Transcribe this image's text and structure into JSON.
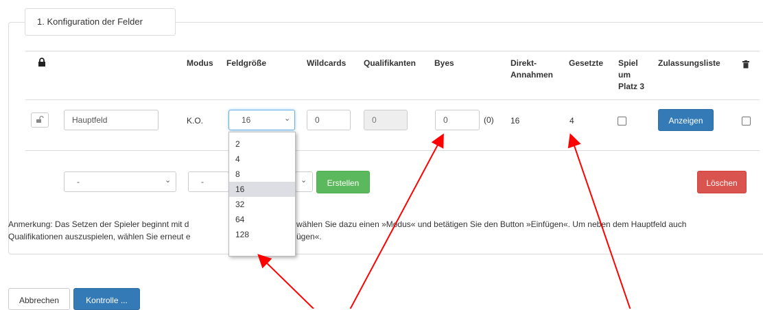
{
  "section_title": "1. Konfiguration der Felder",
  "headers": {
    "modus": "Modus",
    "feldgroesse": "Feldgröße",
    "wildcards": "Wildcards",
    "qualifikanten": "Qualifikanten",
    "byes": "Byes",
    "direkt_l1": "Direkt-",
    "direkt_l2": "Annahmen",
    "gesetzte": "Gesetzte",
    "spiel_l1": "Spiel",
    "spiel_l2": "um",
    "spiel_l3": "Platz 3",
    "zulassung": "Zulassungsliste"
  },
  "row": {
    "name": "Hauptfeld",
    "modus": "K.O.",
    "feldgroesse": "16",
    "wildcards": "0",
    "qualifikanten": "0",
    "byes": "0",
    "byes_hint": "(0)",
    "direkt": "16",
    "gesetzte": "4",
    "spiel_um_platz3": false,
    "zulassung_button": "Anzeigen",
    "delete_checked": false
  },
  "feldgroesse_options": [
    "2",
    "4",
    "8",
    "16",
    "32",
    "64",
    "128"
  ],
  "feldgroesse_selected": "16",
  "create_row": {
    "select1": "-",
    "select2": "-",
    "create_button": "Erstellen",
    "delete_button": "Löschen"
  },
  "note_line1_a": "Anmerkung: Das Setzen der Spieler beginnt mit d",
  "note_line1_b": "wählen Sie dazu einen »Modus« und betätigen Sie den Button »Einfügen«. Um neben dem Hauptfeld auch",
  "note_line2_a": "Qualifikationen auszuspielen, wählen Sie erneut e",
  "note_line2_b": "ügen«.",
  "footer": {
    "cancel": "Abbrechen",
    "check": "Kontrolle ..."
  },
  "colors": {
    "primary": "#337ab7",
    "success": "#5cb85c",
    "danger": "#d9534f",
    "annotation": "#ff0000"
  },
  "icons": {
    "lock": "lock-icon",
    "unlock": "unlock-icon",
    "trash": "trash-icon",
    "caret": "chevron-down-icon"
  }
}
